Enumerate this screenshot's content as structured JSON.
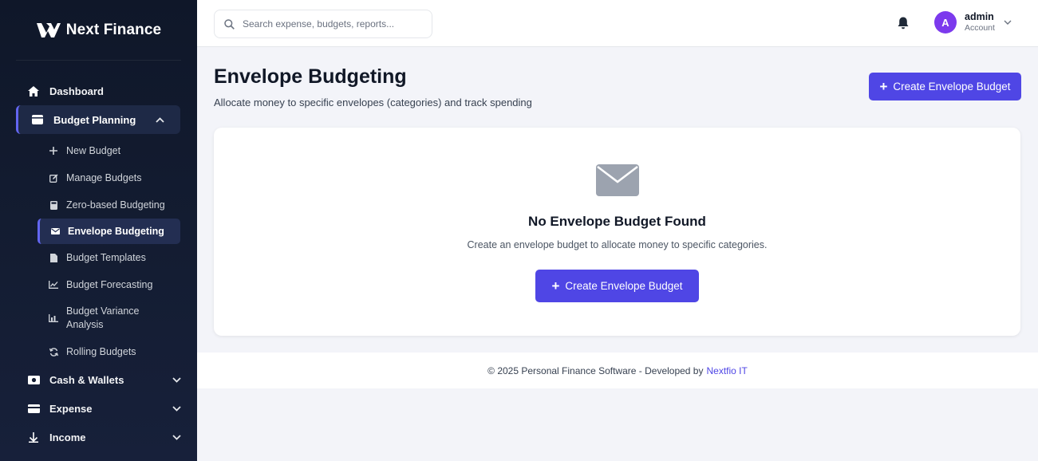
{
  "brand": {
    "name": "Next Finance"
  },
  "search": {
    "placeholder": "Search expense, budgets, reports..."
  },
  "user": {
    "initial": "A",
    "name": "admin",
    "role": "Account"
  },
  "sidebar": {
    "dashboard": "Dashboard",
    "budget_planning": "Budget Planning",
    "budget_sub": [
      "New Budget",
      "Manage Budgets",
      "Zero-based Budgeting",
      "Envelope Budgeting",
      "Budget Templates",
      "Budget Forecasting",
      "Budget Variance Analysis",
      "Rolling Budgets"
    ],
    "cash_wallets": "Cash & Wallets",
    "expense": "Expense",
    "income": "Income"
  },
  "page": {
    "title": "Envelope Budgeting",
    "subtitle": "Allocate money to specific envelopes (categories) and track spending",
    "create_button": "Create Envelope Budget"
  },
  "empty": {
    "title": "No Envelope Budget Found",
    "subtitle": "Create an envelope budget to allocate money to specific categories.",
    "button": "Create Envelope Budget"
  },
  "footer": {
    "text": "© 2025 Personal Finance Software - Developed by",
    "link": "Nextfio IT"
  },
  "colors": {
    "accent": "#4f46e5",
    "sidebar_bg": "#0f1729",
    "avatar": "#7c3aed"
  }
}
